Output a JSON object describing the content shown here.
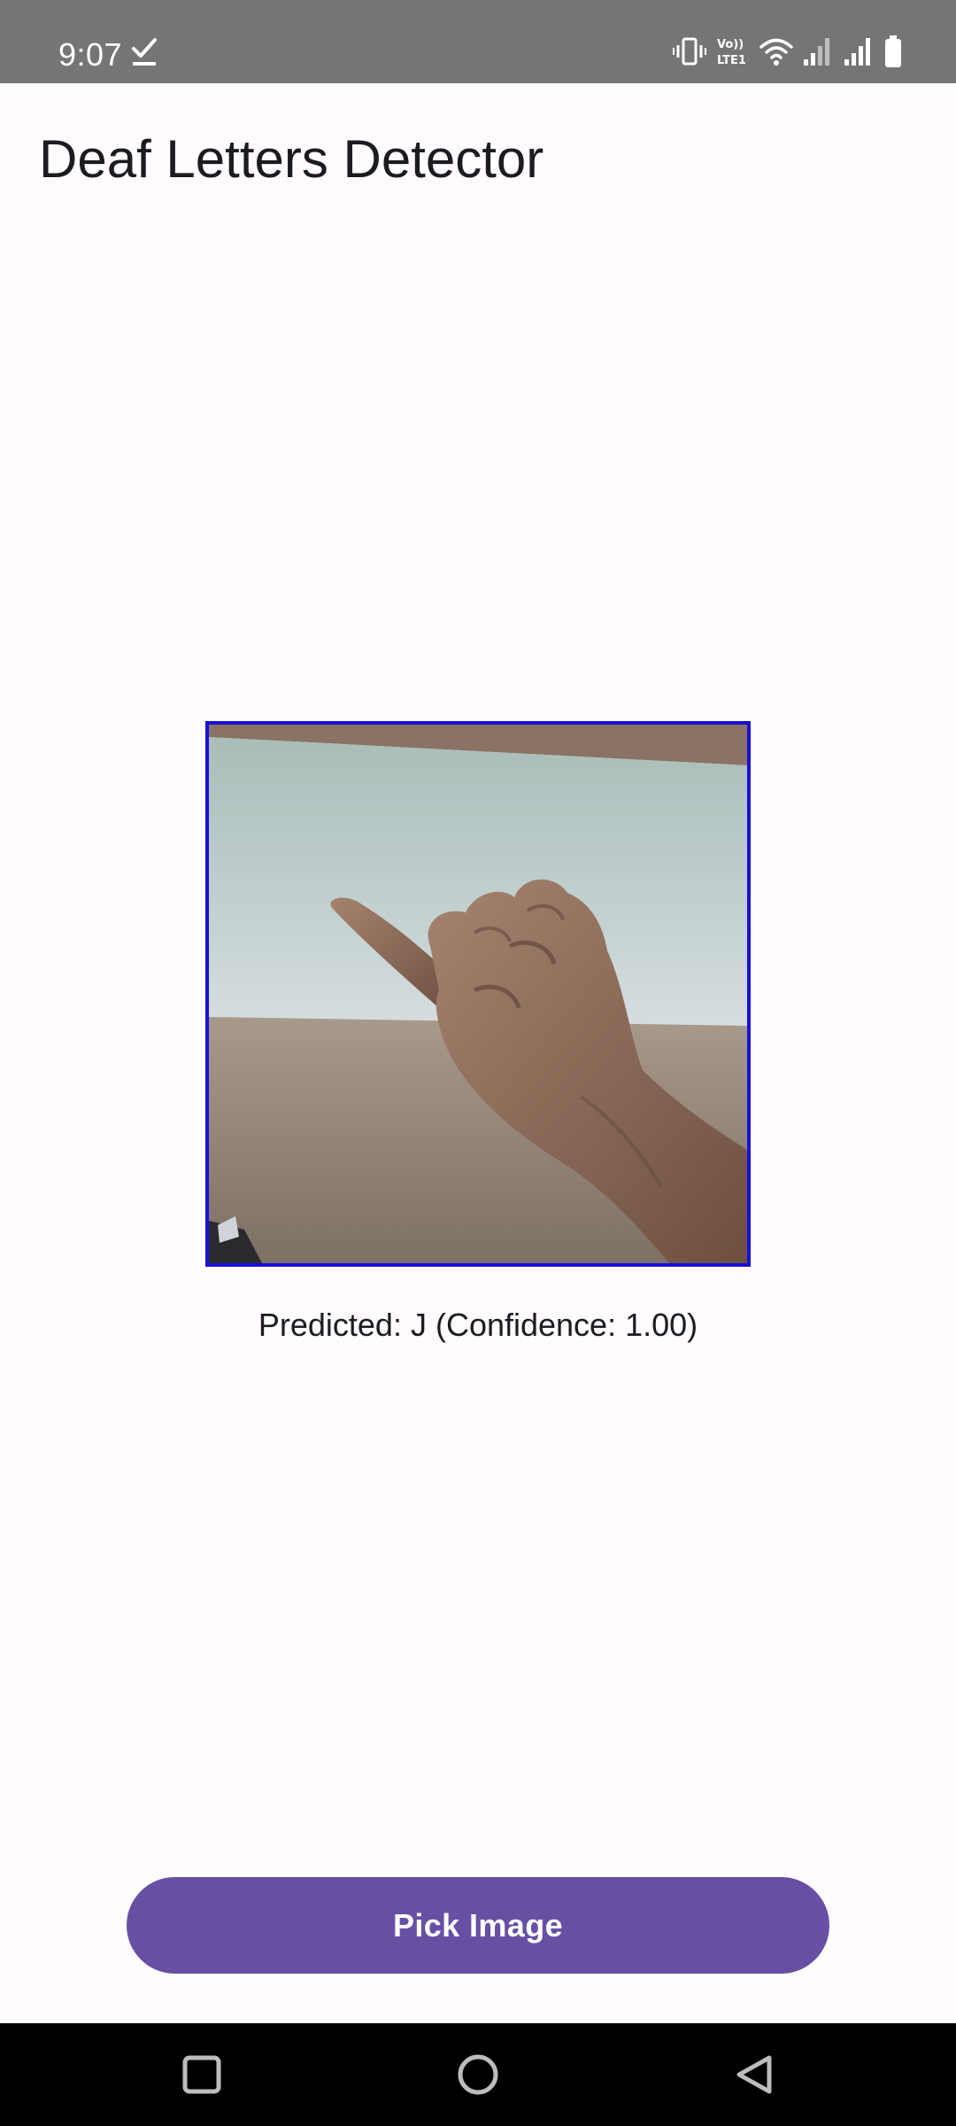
{
  "status_bar": {
    "time": "9:07",
    "icons": [
      "check-icon",
      "vibrate-icon",
      "volte-icon",
      "wifi-icon",
      "signal-icon",
      "signal-icon",
      "battery-icon"
    ],
    "volte_text": "Vo))\nLTE1"
  },
  "app": {
    "title": "Deaf Letters Detector"
  },
  "preview": {
    "border_color": "#1a10d9",
    "description_icon": "hand-sign-image"
  },
  "prediction": {
    "text": "Predicted: J (Confidence: 1.00)"
  },
  "actions": {
    "pick_image_label": "Pick Image",
    "button_color": "#6750a4"
  },
  "navigation": {
    "items": [
      "recents-icon",
      "home-icon",
      "back-icon"
    ]
  }
}
